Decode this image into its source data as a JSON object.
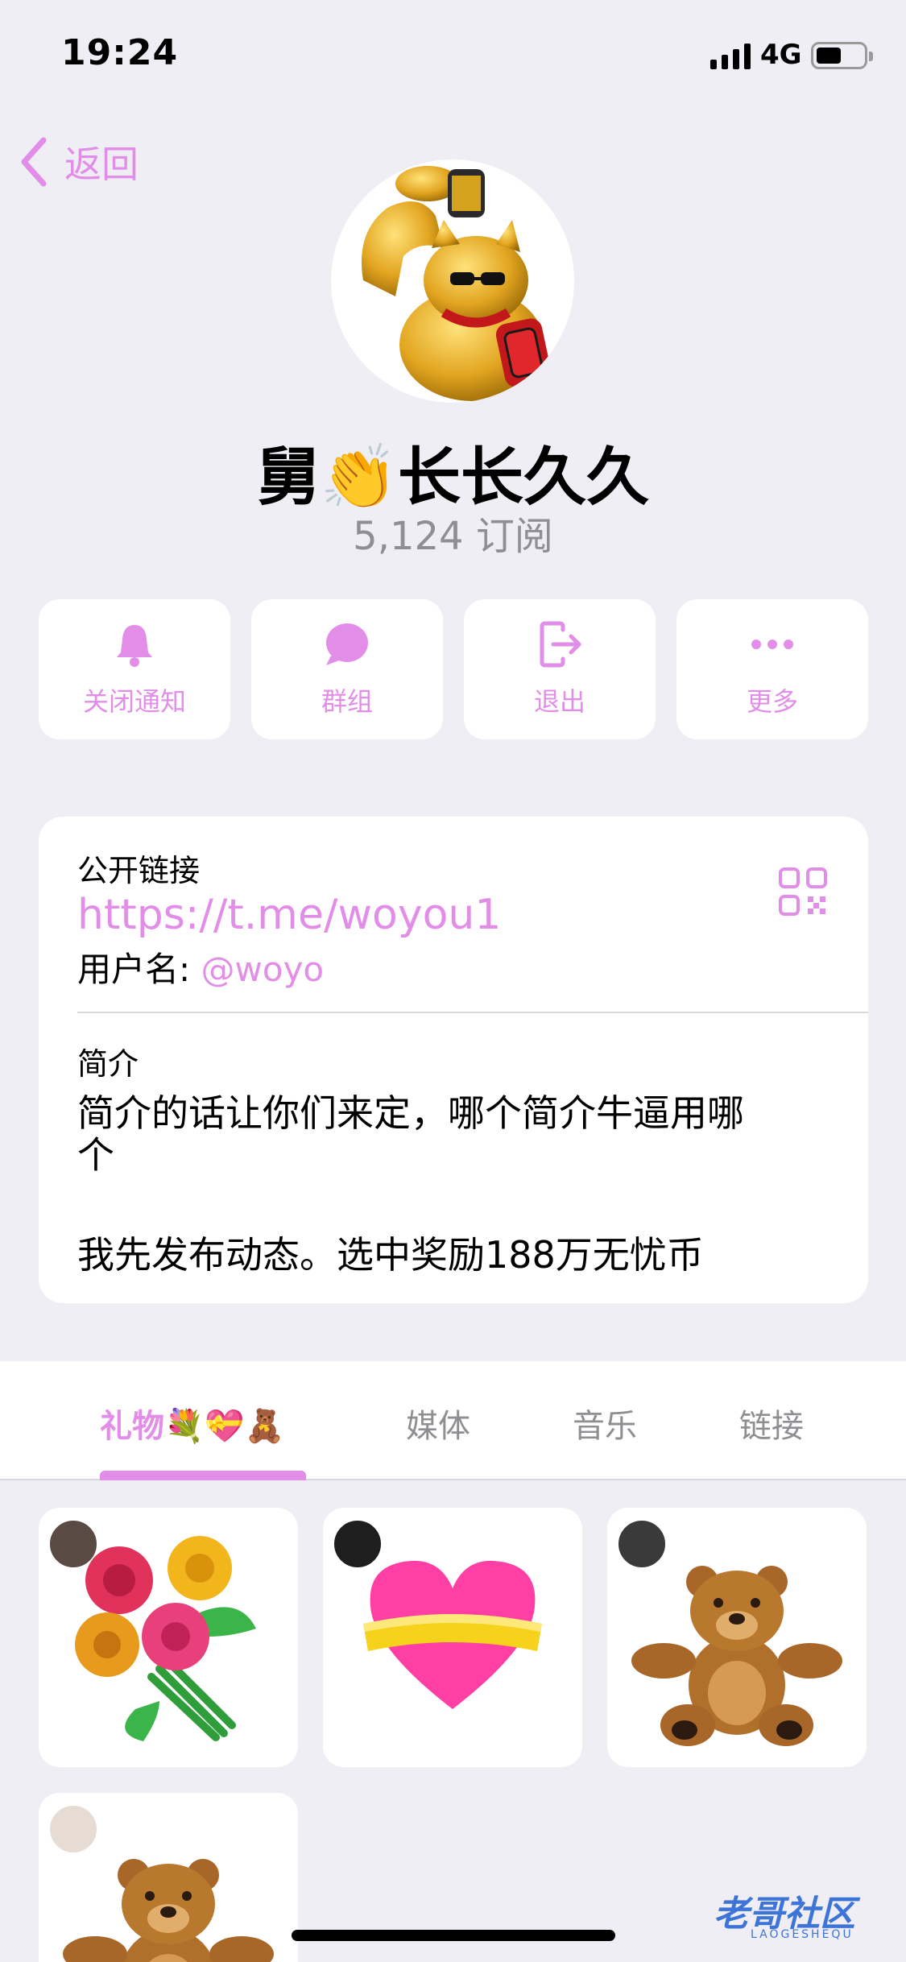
{
  "status_bar": {
    "time": "19:24",
    "network": "4G"
  },
  "nav": {
    "back_label": "返回"
  },
  "channel": {
    "name": "舅👏长长久久",
    "subscribers": "5,124 订阅"
  },
  "actions": [
    {
      "label": "关闭通知",
      "icon": "bell-icon"
    },
    {
      "label": "群组",
      "icon": "chat-bubble-icon"
    },
    {
      "label": "退出",
      "icon": "leave-icon"
    },
    {
      "label": "更多",
      "icon": "more-icon"
    }
  ],
  "info": {
    "public_link_title": "公开链接",
    "link": "https://t.me/woyou1",
    "username_label": "用户名: ",
    "username": "@woyo",
    "bio_title": "简介",
    "bio_lines": [
      "简介的话让你们来定，哪个简介牛逼用哪",
      "个",
      "",
      "我先发布动态。选中奖励188万无忧币"
    ]
  },
  "tabs": [
    {
      "label": "礼物💐💝🧸",
      "active": true
    },
    {
      "label": "媒体",
      "active": false
    },
    {
      "label": "音乐",
      "active": false
    },
    {
      "label": "链接",
      "active": false
    }
  ],
  "gifts": [
    {
      "name": "bouquet"
    },
    {
      "name": "heart"
    },
    {
      "name": "teddy-bear"
    },
    {
      "name": "teddy-bear"
    }
  ],
  "watermark": {
    "text": "老哥社区",
    "sub": "LAOGESHEQU"
  },
  "colors": {
    "accent": "#e28ee8",
    "background": "#efeef4",
    "muted": "#8e8e93"
  }
}
